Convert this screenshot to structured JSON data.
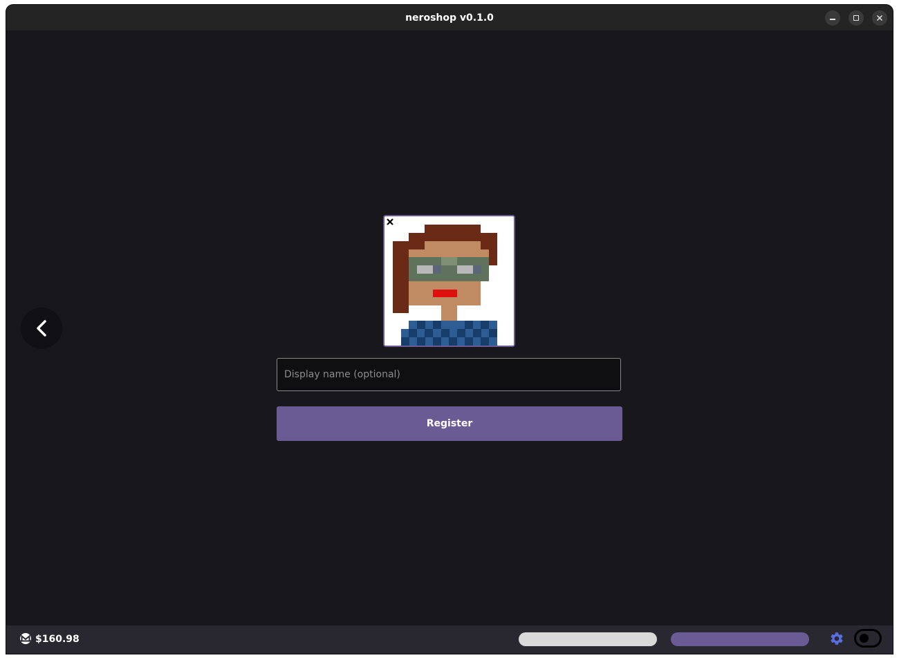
{
  "window": {
    "title": "neroshop v0.1.0"
  },
  "icons": {
    "back": "chevron-left-icon",
    "avatar_close": "close-icon",
    "currency": "monero-icon",
    "settings": "gear-icon",
    "theme": "toggle-icon",
    "minimize": "minimize-icon",
    "maximize": "maximize-icon",
    "close": "close-icon"
  },
  "register_form": {
    "display_name": {
      "value": "",
      "placeholder": "Display name (optional)"
    },
    "register_label": "Register"
  },
  "statusbar": {
    "balance": "$160.98",
    "progress_bars": [
      {
        "color": "#d9d9d9",
        "fill": 1.0
      },
      {
        "color": "#6b5b95",
        "fill": 1.0
      }
    ],
    "theme_toggle_on": false
  },
  "colors": {
    "accent": "#6b5b95",
    "background": "#18171c",
    "titlebar": "#242424",
    "statusbar": "#292831",
    "settings_icon": "#5b6ee1"
  }
}
